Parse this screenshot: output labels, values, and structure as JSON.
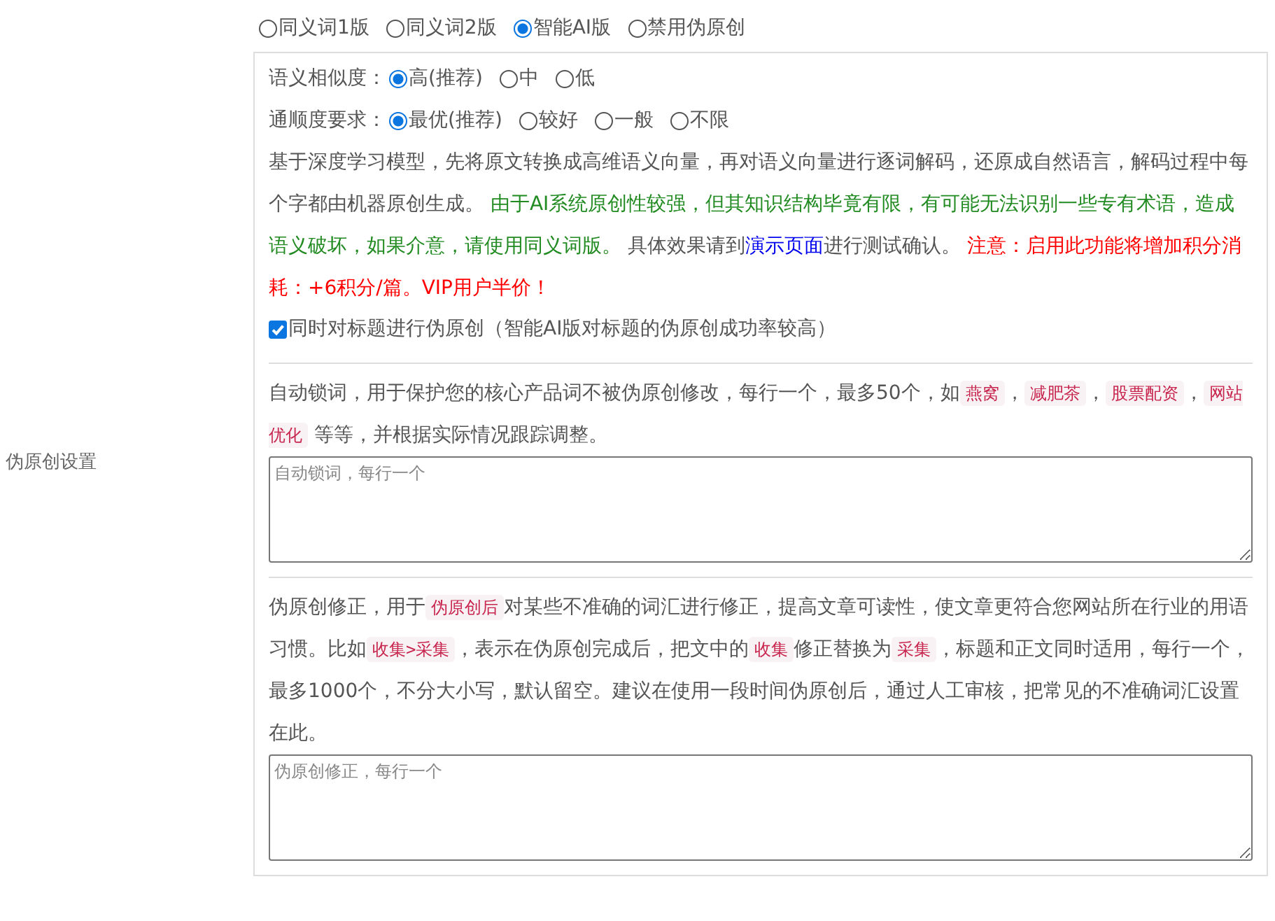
{
  "section_label": "伪原创设置",
  "mode_options": [
    {
      "label": "同义词1版",
      "selected": false
    },
    {
      "label": "同义词2版",
      "selected": false
    },
    {
      "label": "智能AI版",
      "selected": true
    },
    {
      "label": "禁用伪原创",
      "selected": false
    }
  ],
  "similarity": {
    "label": "语义相似度：",
    "options": [
      {
        "label": "高(推荐)",
        "selected": true
      },
      {
        "label": "中",
        "selected": false
      },
      {
        "label": "低",
        "selected": false
      }
    ]
  },
  "fluency": {
    "label": "通顺度要求：",
    "options": [
      {
        "label": "最优(推荐)",
        "selected": true
      },
      {
        "label": "较好",
        "selected": false
      },
      {
        "label": "一般",
        "selected": false
      },
      {
        "label": "不限",
        "selected": false
      }
    ]
  },
  "description": [
    {
      "kind": "plain",
      "text": "基于深度学习模型，先将原文转换成高维语义向量，再对语义向量进行逐词解码，还原成自然语言，解码过程中每个字都由机器原创生成。 "
    },
    {
      "kind": "green",
      "text": "由于AI系统原创性较强，但其知识结构毕竟有限，有可能无法识别一些专有术语，造成语义破坏，如果介意，请使用同义词版。"
    },
    {
      "kind": "plain",
      "text": " 具体效果请到"
    },
    {
      "kind": "link",
      "text": "演示页面"
    },
    {
      "kind": "plain",
      "text": "进行测试确认。 "
    },
    {
      "kind": "red",
      "text": "注意：启用此功能将增加积分消耗：+6积分/篇。VIP用户半价！"
    }
  ],
  "title_option": {
    "label": "同时对标题进行伪原创（智能AI版对标题的伪原创成功率较高）",
    "checked": true
  },
  "lock_words": {
    "description": [
      {
        "kind": "plain",
        "text": "自动锁词，用于保护您的核心产品词不被伪原创修改，每行一个，最多50个，如"
      },
      {
        "kind": "code",
        "text": "燕窝"
      },
      {
        "kind": "plain",
        "text": "，"
      },
      {
        "kind": "code",
        "text": "减肥茶"
      },
      {
        "kind": "plain",
        "text": "，"
      },
      {
        "kind": "code",
        "text": "股票配资"
      },
      {
        "kind": "plain",
        "text": "，"
      },
      {
        "kind": "code",
        "text": "网站优化"
      },
      {
        "kind": "plain",
        "text": " 等等，并根据实际情况跟踪调整。"
      }
    ],
    "placeholder": "自动锁词，每行一个"
  },
  "corrections": {
    "description": [
      {
        "kind": "plain",
        "text": "伪原创修正，用于"
      },
      {
        "kind": "code",
        "text": "伪原创后"
      },
      {
        "kind": "plain",
        "text": "对某些不准确的词汇进行修正，提高文章可读性，使文章更符合您网站所在行业的用语习惯。比如"
      },
      {
        "kind": "code",
        "text": "收集>采集"
      },
      {
        "kind": "plain",
        "text": "，表示在伪原创完成后，把文中的"
      },
      {
        "kind": "code",
        "text": "收集"
      },
      {
        "kind": "plain",
        "text": "修正替换为"
      },
      {
        "kind": "code",
        "text": "采集"
      },
      {
        "kind": "plain",
        "text": "，标题和正文同时适用，每行一个，最多1000个，不分大小写，默认留空。建议在使用一段时间伪原创后，通过人工审核，把常见的不准确词汇设置在此。"
      }
    ],
    "placeholder": "伪原创修正，每行一个"
  }
}
